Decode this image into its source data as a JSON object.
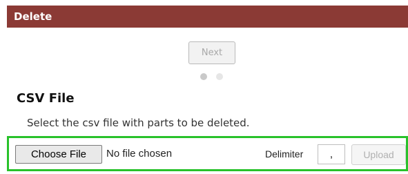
{
  "header": {
    "title": "Delete"
  },
  "wizard": {
    "next_label": "Next",
    "step_total": 2,
    "step_current": 1
  },
  "csv": {
    "title": "CSV File",
    "description": "Select the csv file with parts to be deleted.",
    "choose_label": "Choose File",
    "file_status": "No file chosen",
    "delimiter_label": "Delimiter",
    "delimiter_value": ",",
    "upload_label": "Upload"
  },
  "colors": {
    "header_bg": "#8b3a35",
    "highlight_border": "#28c22a"
  }
}
